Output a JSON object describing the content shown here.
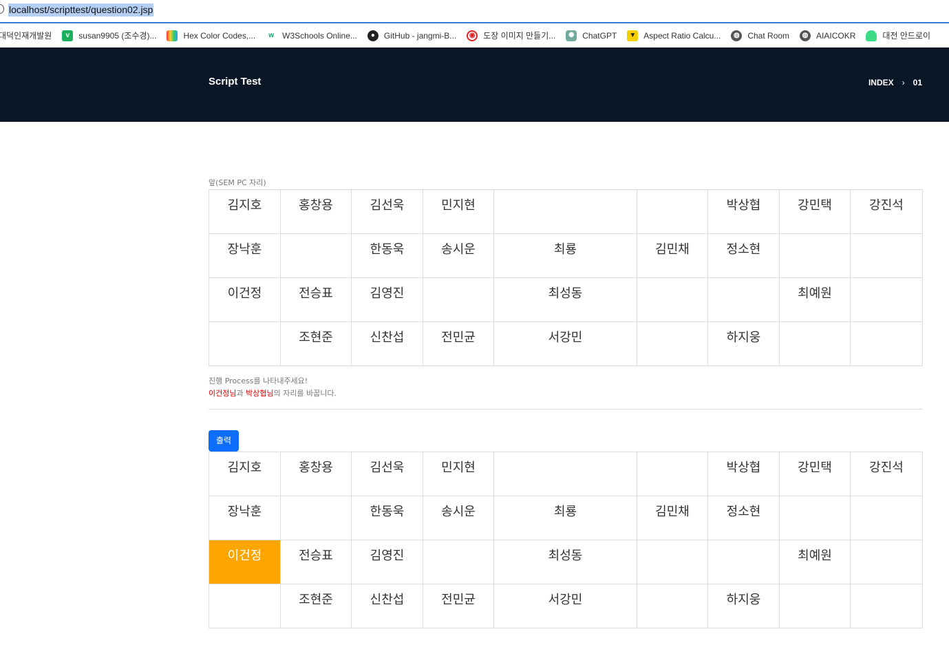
{
  "address_bar": {
    "url": "localhost/scripttest/question02.jsp"
  },
  "bookmarks": [
    {
      "icon": "globe-icon",
      "label": "대덕인재개발원"
    },
    {
      "icon": "v-icon",
      "label": "susan9905 (조수경)..."
    },
    {
      "icon": "color-codes-icon",
      "label": "Hex Color Codes,..."
    },
    {
      "icon": "w3schools-icon",
      "label": "W3Schools Online..."
    },
    {
      "icon": "github-icon",
      "label": "GitHub - jangmi-B..."
    },
    {
      "icon": "stamp-icon",
      "label": "도장 이미지 만들기..."
    },
    {
      "icon": "chatgpt-icon",
      "label": "ChatGPT"
    },
    {
      "icon": "aspect-ratio-icon",
      "label": "Aspect Ratio Calcu..."
    },
    {
      "icon": "globe-icon",
      "label": "Chat Room"
    },
    {
      "icon": "globe-icon",
      "label": "AIAICOKR"
    },
    {
      "icon": "android-icon",
      "label": "대전 안드로이"
    }
  ],
  "header": {
    "brand": "Script Test",
    "breadcrumb": {
      "index": "INDEX",
      "separator": "›",
      "current": "01"
    }
  },
  "front_caption": "앞(SEM PC 자리)",
  "seats_top": [
    [
      "김지호",
      "홍창용",
      "김선욱",
      "민지현",
      "",
      "",
      "박상협",
      "강민택",
      "강진석"
    ],
    [
      "장낙훈",
      "",
      "한동욱",
      "송시운",
      "최룡",
      "김민채",
      "정소현",
      "",
      ""
    ],
    [
      "이건정",
      "전승표",
      "김영진",
      "",
      "최성동",
      "",
      "",
      "최예원",
      ""
    ],
    [
      "",
      "조현준",
      "신찬섭",
      "전민균",
      "서강민",
      "",
      "하지웅",
      "",
      ""
    ]
  ],
  "notes": {
    "line1": "진행 Process를 나타내주세요!",
    "line2_name1": "이건정님",
    "line2_mid": "과 ",
    "line2_name2": "박상협님",
    "line2_end": "의 자리를 바꿉니다."
  },
  "print_button": "출력",
  "seats_bottom": [
    [
      "김지호",
      "홍창용",
      "김선욱",
      "민지현",
      "",
      "",
      "박상협",
      "강민택",
      "강진석"
    ],
    [
      "장낙훈",
      "",
      "한동욱",
      "송시운",
      "최룡",
      "김민채",
      "정소현",
      "",
      ""
    ],
    [
      "이건정",
      "전승표",
      "김영진",
      "",
      "최성동",
      "",
      "",
      "최예원",
      ""
    ],
    [
      "",
      "조현준",
      "신찬섭",
      "전민균",
      "서강민",
      "",
      "하지웅",
      "",
      ""
    ]
  ],
  "highlight_color": "#ffa500",
  "header_color": "#0b1726",
  "button_color": "#0d6efd"
}
